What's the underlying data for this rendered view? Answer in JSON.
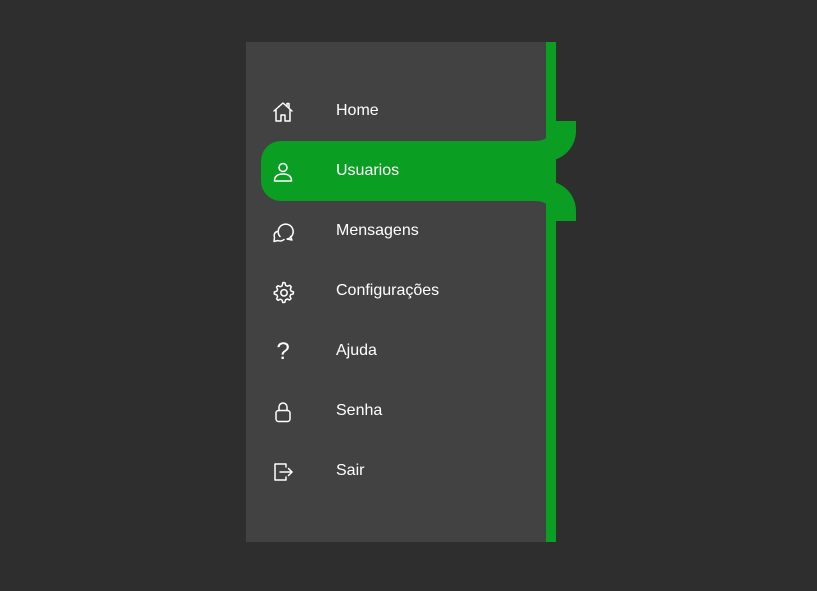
{
  "colors": {
    "background": "#2e2e2e",
    "panel": "#424242",
    "accent": "#0a9e23",
    "text": "#ffffff"
  },
  "menu": {
    "active": "Usuarios",
    "items": [
      {
        "label": "Home",
        "icon": "home-icon"
      },
      {
        "label": "Usuarios",
        "icon": "user-icon"
      },
      {
        "label": "Mensagens",
        "icon": "chat-icon"
      },
      {
        "label": "Configurações",
        "icon": "gear-icon"
      },
      {
        "label": "Ajuda",
        "icon": "help-icon",
        "glyph": "?"
      },
      {
        "label": "Senha",
        "icon": "lock-icon"
      },
      {
        "label": "Sair",
        "icon": "logout-icon"
      }
    ]
  }
}
